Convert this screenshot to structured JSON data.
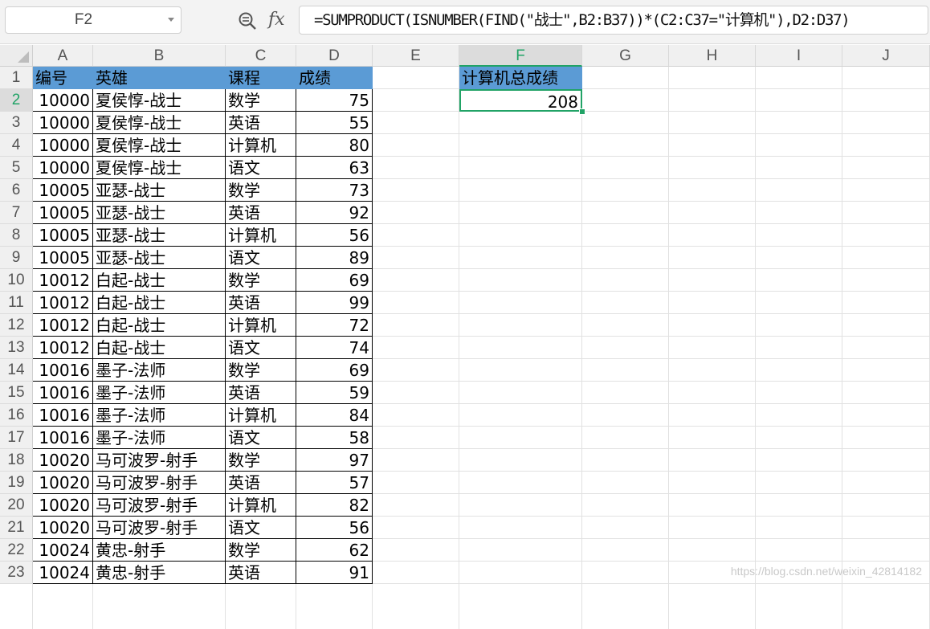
{
  "formula_bar": {
    "name_box": "F2",
    "formula": "=SUMPRODUCT(ISNUMBER(FIND(\"战士\",B2:B37))*(C2:C37=\"计算机\"),D2:D37)",
    "icons": [
      "zoom-icon",
      "fx-icon"
    ]
  },
  "columns": [
    "A",
    "B",
    "C",
    "D",
    "E",
    "F",
    "G",
    "H",
    "I",
    "J"
  ],
  "active_column": "F",
  "active_row": "2",
  "rows": [
    "1",
    "2",
    "3",
    "4",
    "5",
    "6",
    "7",
    "8",
    "9",
    "10",
    "11",
    "12",
    "13",
    "14",
    "15",
    "16",
    "17",
    "18",
    "19",
    "20",
    "21",
    "22",
    "23"
  ],
  "table": {
    "headers": [
      "编号",
      "英雄",
      "课程",
      "成绩"
    ],
    "rows": [
      [
        "10000",
        "夏侯惇-战士",
        "数学",
        "75"
      ],
      [
        "10000",
        "夏侯惇-战士",
        "英语",
        "55"
      ],
      [
        "10000",
        "夏侯惇-战士",
        "计算机",
        "80"
      ],
      [
        "10000",
        "夏侯惇-战士",
        "语文",
        "63"
      ],
      [
        "10005",
        "亚瑟-战士",
        "数学",
        "73"
      ],
      [
        "10005",
        "亚瑟-战士",
        "英语",
        "92"
      ],
      [
        "10005",
        "亚瑟-战士",
        "计算机",
        "56"
      ],
      [
        "10005",
        "亚瑟-战士",
        "语文",
        "89"
      ],
      [
        "10012",
        "白起-战士",
        "数学",
        "69"
      ],
      [
        "10012",
        "白起-战士",
        "英语",
        "99"
      ],
      [
        "10012",
        "白起-战士",
        "计算机",
        "72"
      ],
      [
        "10012",
        "白起-战士",
        "语文",
        "74"
      ],
      [
        "10016",
        "墨子-法师",
        "数学",
        "69"
      ],
      [
        "10016",
        "墨子-法师",
        "英语",
        "59"
      ],
      [
        "10016",
        "墨子-法师",
        "计算机",
        "84"
      ],
      [
        "10016",
        "墨子-法师",
        "语文",
        "58"
      ],
      [
        "10020",
        "马可波罗-射手",
        "数学",
        "97"
      ],
      [
        "10020",
        "马可波罗-射手",
        "英语",
        "57"
      ],
      [
        "10020",
        "马可波罗-射手",
        "计算机",
        "82"
      ],
      [
        "10020",
        "马可波罗-射手",
        "语文",
        "56"
      ],
      [
        "10024",
        "黄忠-射手",
        "数学",
        "62"
      ],
      [
        "10024",
        "黄忠-射手",
        "英语",
        "91"
      ]
    ]
  },
  "summary": {
    "header": "计算机总成绩",
    "value": "208"
  },
  "colors": {
    "header_fill": "#5b9bd5",
    "selection": "#21a366"
  },
  "watermark": "https://blog.csdn.net/weixin_42814182"
}
